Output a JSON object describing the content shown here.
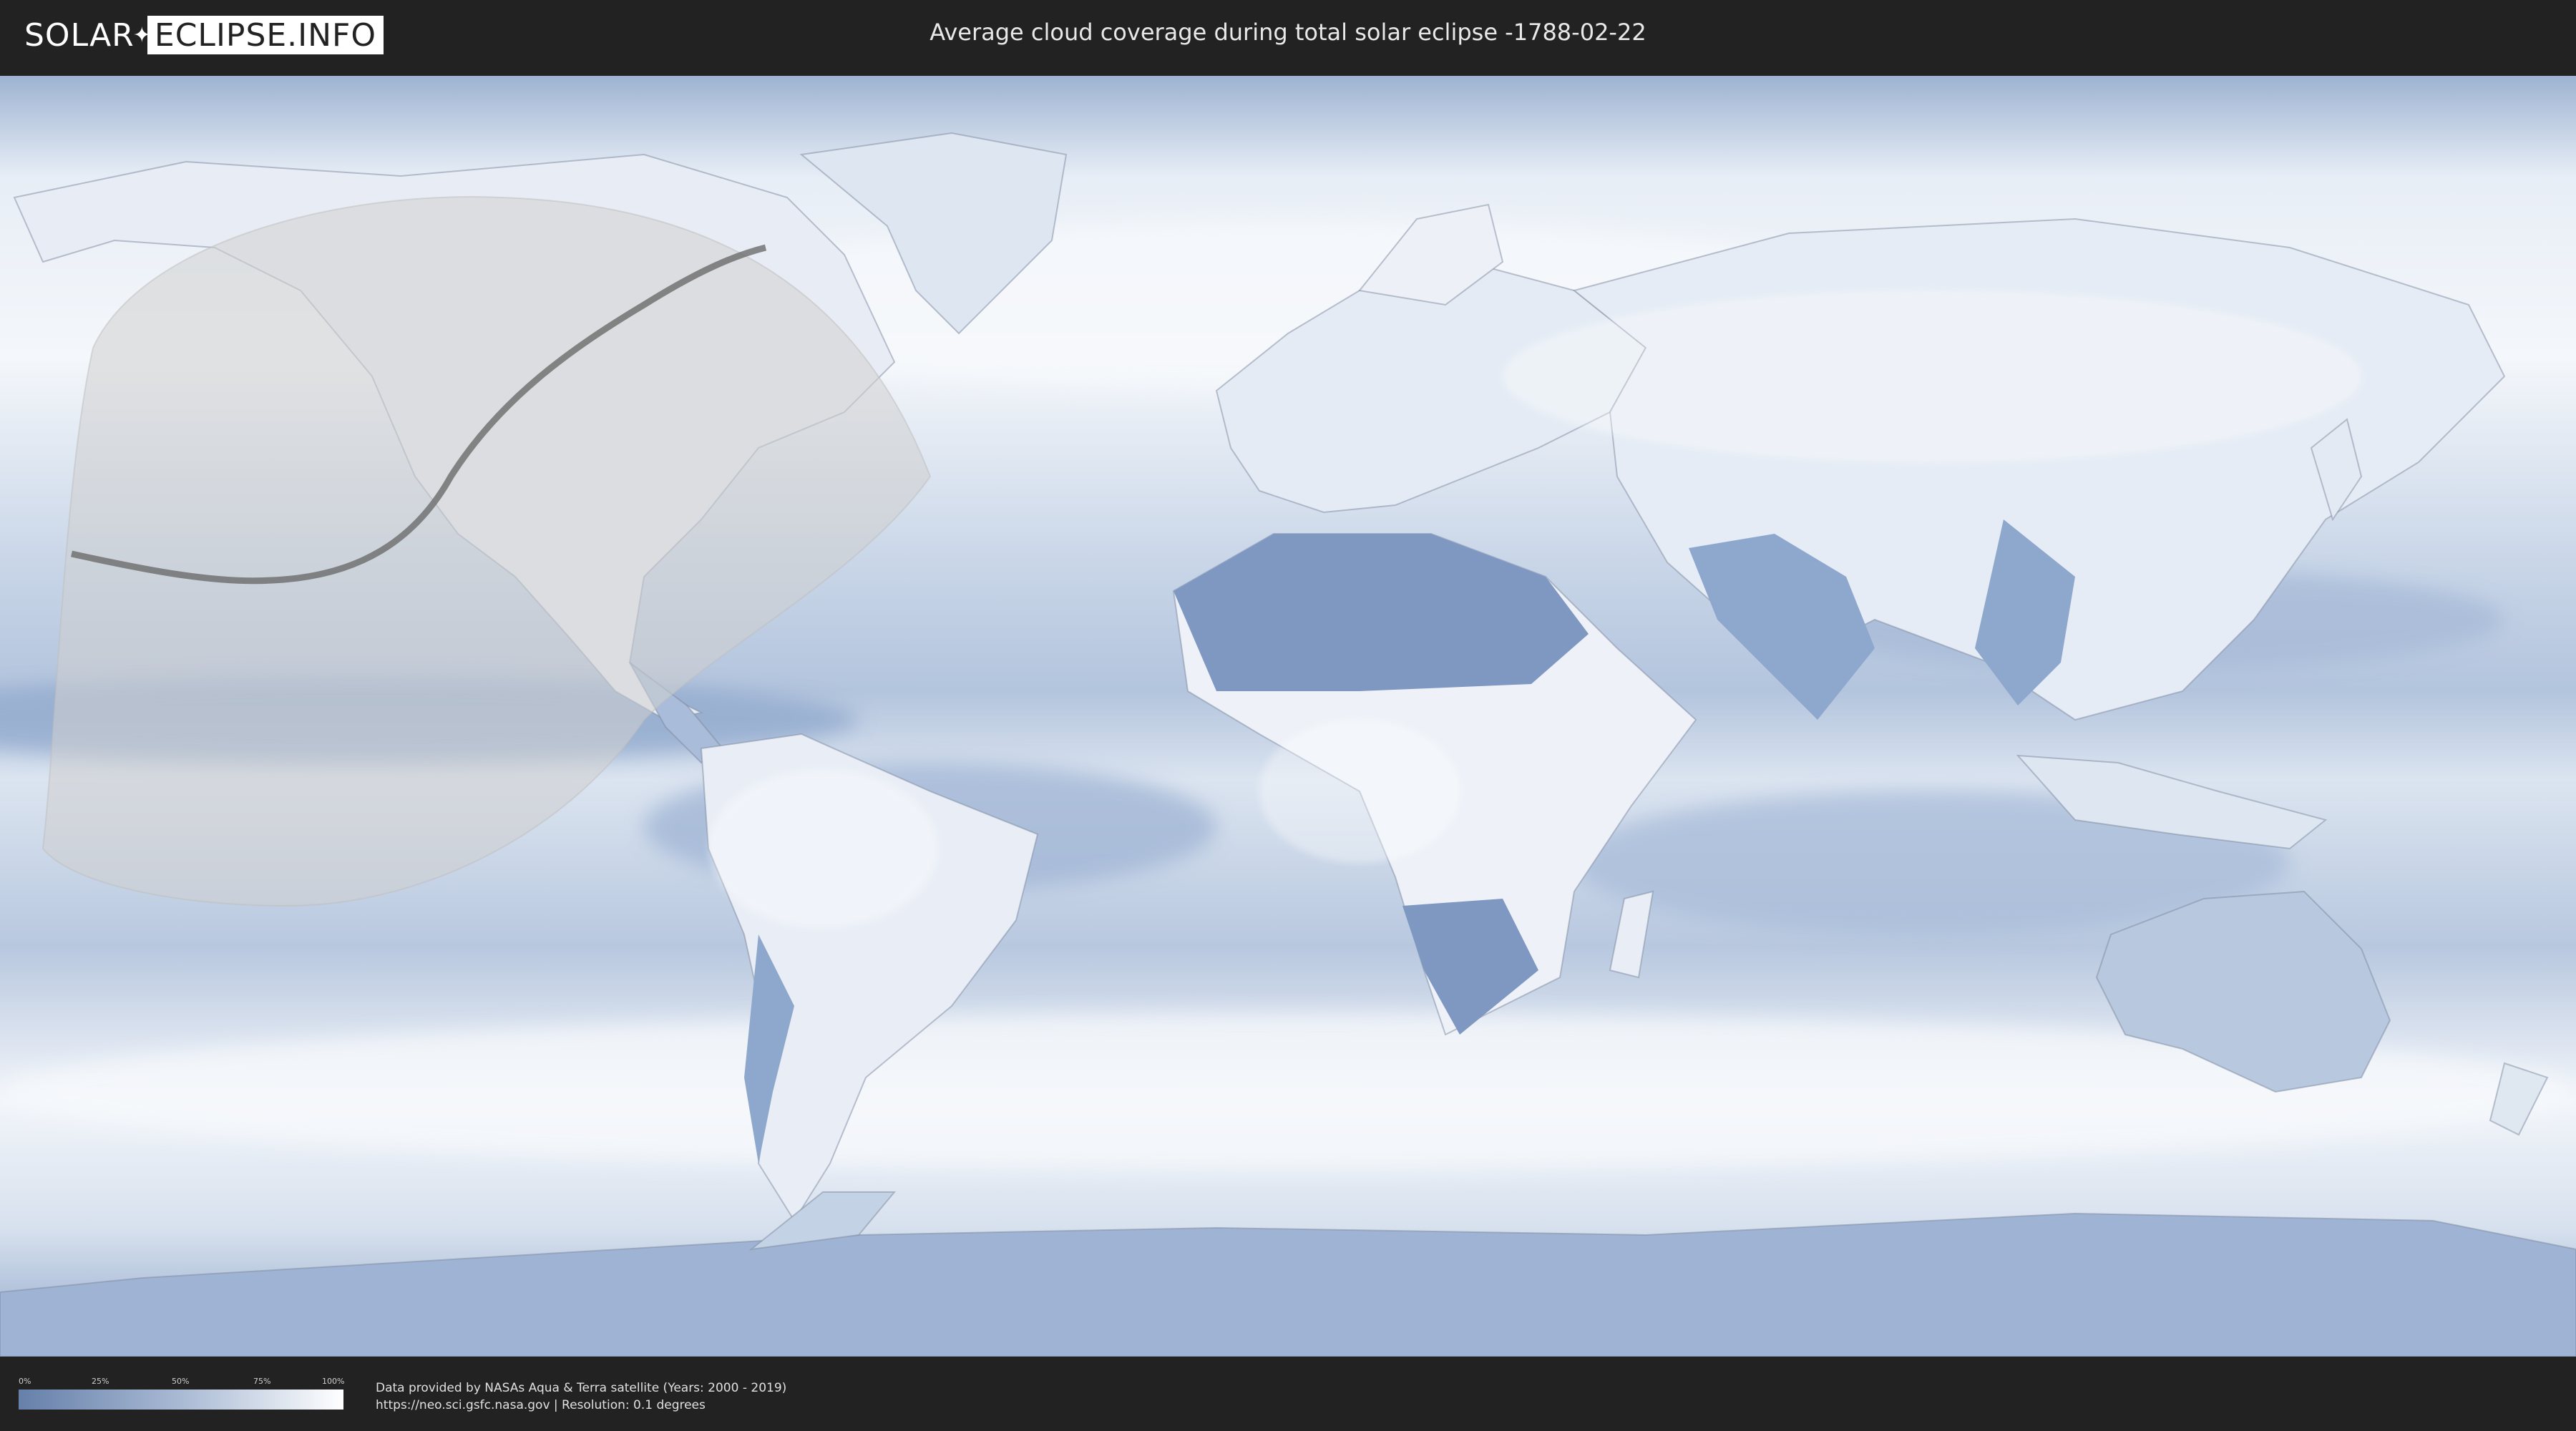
{
  "header": {
    "logo_left": "SOLAR",
    "logo_right": "ECLIPSE.INFO",
    "title": "Average cloud coverage during total solar eclipse -1788-02-22"
  },
  "map": {
    "colors": {
      "clear_sky": "#6680aa",
      "overcast": "#ffffff",
      "land_border": "#7d8aa0",
      "eclipse_zone": "#cfcfcf",
      "totality_path": "#6b6b6b"
    }
  },
  "legend": {
    "ticks": [
      "0%",
      "25%",
      "50%",
      "75%",
      "100%"
    ]
  },
  "credits": {
    "line1": "Data provided by NASAs Aqua & Terra satellite (Years: 2000 - 2019)",
    "line2": "https://neo.sci.gsfc.nasa.gov | Resolution: 0.1 degrees"
  }
}
